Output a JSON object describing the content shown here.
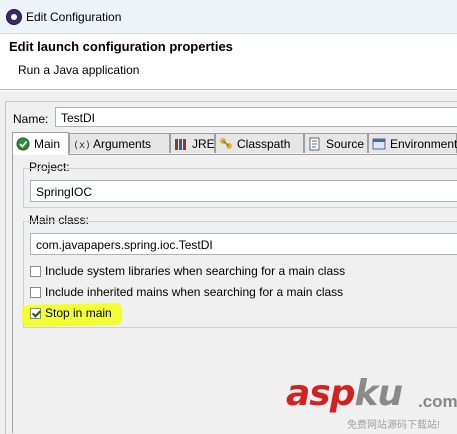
{
  "window": {
    "title": "Edit Configuration"
  },
  "header": {
    "title": "Edit launch configuration properties",
    "subtitle": "Run a Java application"
  },
  "name_field": {
    "label": "Name:",
    "value": "TestDI"
  },
  "tabs": [
    {
      "label": "Main",
      "icon": "main-icon",
      "active": true
    },
    {
      "label": "Arguments",
      "icon": "arguments-icon",
      "active": false
    },
    {
      "label": "JRE",
      "icon": "jre-icon",
      "active": false
    },
    {
      "label": "Classpath",
      "icon": "classpath-icon",
      "active": false
    },
    {
      "label": "Source",
      "icon": "source-icon",
      "active": false
    },
    {
      "label": "Environment",
      "icon": "environment-icon",
      "active": false
    }
  ],
  "main_tab": {
    "project": {
      "label": "Project:",
      "value": "SpringIOC"
    },
    "main_class": {
      "label": "Main class:",
      "value": "com.javapapers.spring.ioc.TestDI"
    },
    "options": [
      {
        "label": "Include system libraries when searching for a main class",
        "checked": false
      },
      {
        "label": "Include inherited mains when searching for a main class",
        "checked": false
      },
      {
        "label": "Stop in main",
        "checked": true
      }
    ]
  },
  "watermark": {
    "brand_red": "asp",
    "brand_gray": "ku",
    "suffix": ".com",
    "tagline": "免费网站源码下载站!"
  },
  "colors": {
    "highlight": "#f2ff2a",
    "watermark_red": "#d42020",
    "watermark_gray": "#888888"
  }
}
